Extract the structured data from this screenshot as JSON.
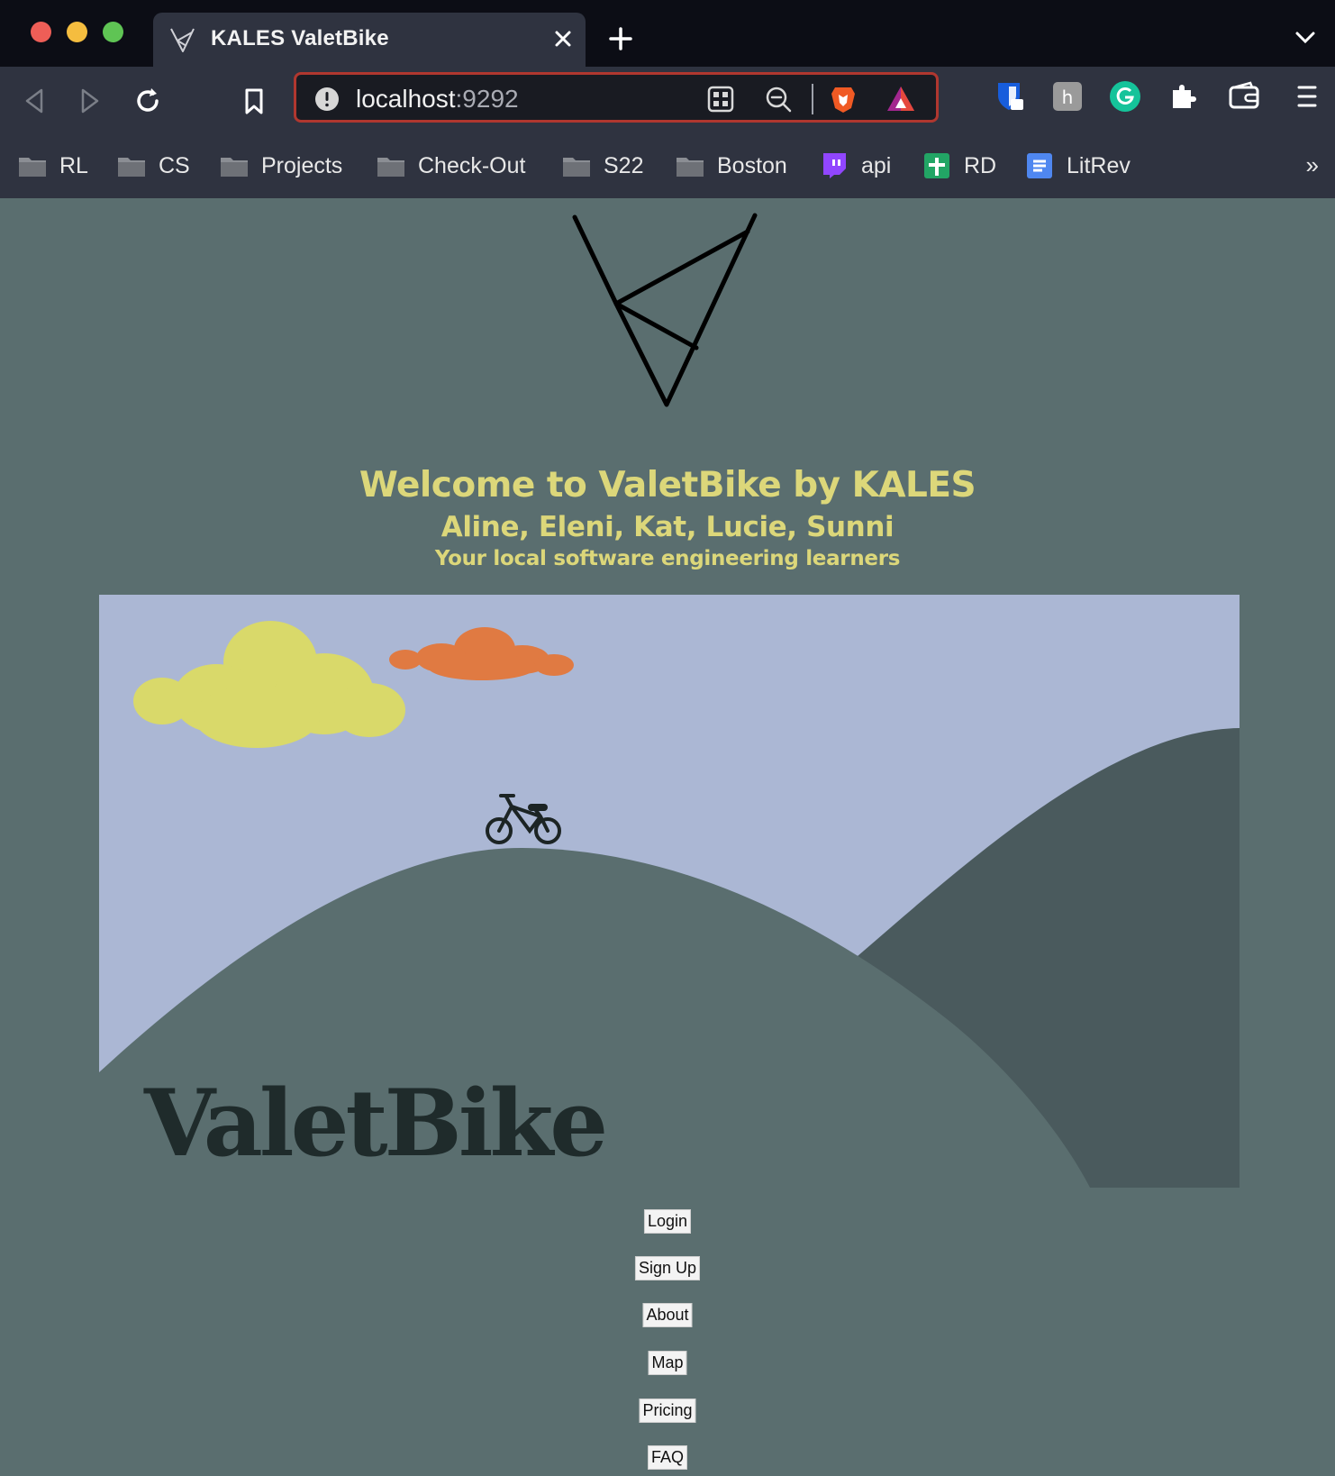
{
  "browser": {
    "tab_title": "KALES ValetBike",
    "url_host": "localhost",
    "url_port": ":9292",
    "bookmarks": [
      {
        "label": "RL",
        "icon": "folder-icon"
      },
      {
        "label": "CS",
        "icon": "folder-icon"
      },
      {
        "label": "Projects",
        "icon": "folder-icon"
      },
      {
        "label": "Check-Out",
        "icon": "folder-icon"
      },
      {
        "label": "S22",
        "icon": "folder-icon"
      },
      {
        "label": "Boston",
        "icon": "folder-icon"
      },
      {
        "label": "api",
        "icon": "twitch-icon"
      },
      {
        "label": "RD",
        "icon": "sheets-icon"
      },
      {
        "label": "LitRev",
        "icon": "docs-icon"
      }
    ],
    "bookmarks_more": "»",
    "colors": {
      "tabbar": "#0c0d15",
      "toolbar": "#2f3340",
      "url_border": "#b0372f"
    }
  },
  "page": {
    "heading": "Welcome to ValetBike by KALES",
    "names": "Aline, Eleni, Kat, Lucie, Sunni",
    "tagline": "Your local software engineering learners",
    "hero_title": "ValetBike",
    "nav": [
      "Login",
      "Sign Up",
      "About",
      "Map",
      "Pricing",
      "FAQ"
    ],
    "colors": {
      "background": "#5a6e6f",
      "heading": "#dcd77a",
      "sky": "#abb7d4",
      "yellow_cloud": "#d9d96a",
      "orange_cloud": "#e07a42",
      "hill_front": "#5a6e6f",
      "hill_back": "#4a5a5d"
    }
  }
}
